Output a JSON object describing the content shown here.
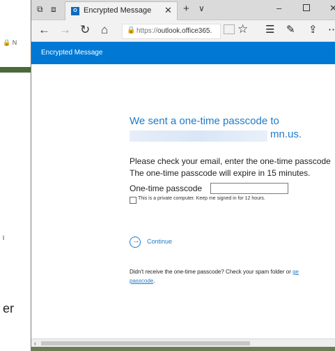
{
  "tab": {
    "title": "Encrypted Message",
    "favicon_text": "O"
  },
  "titlebar": {
    "new_tab": "+",
    "tab_list": "∨",
    "close": "✕",
    "minimize": "–"
  },
  "nav": {
    "url_prefix": "https://",
    "url_host": "outlook.office365.",
    "icons": [
      "back-icon",
      "forward-icon",
      "refresh-icon",
      "home-icon",
      "lock-icon",
      "reading-view-icon",
      "favorite-star-icon",
      "favorites-hub-icon",
      "notes-icon",
      "share-icon",
      "more-icon"
    ]
  },
  "app": {
    "title": "Encrypted Message",
    "accent": "#0078d4"
  },
  "content": {
    "heading": "We sent a one-time passcode to",
    "email_suffix": "mn.us.",
    "para_line1": "Please check your email, enter the one-time passcode",
    "para_line2": "The one-time passcode will expire in 15 minutes.",
    "otp_label": "One-time passcode",
    "otp_value": "",
    "checkbox_label": "This is a private computer. Keep me signed in for 12 hours.",
    "checkbox_checked": false,
    "continue_label": "Continue",
    "resend_text": "Didn't receive the one-time passcode? Check your spam folder or ",
    "resend_link1": "ge",
    "resend_link2": "passcode",
    "resend_end": ".",
    "link_color": "#1f7ac9"
  },
  "background": {
    "bg_text_l": "l",
    "bg_text_er": "er",
    "bg_lock_text": "🔒 N"
  }
}
